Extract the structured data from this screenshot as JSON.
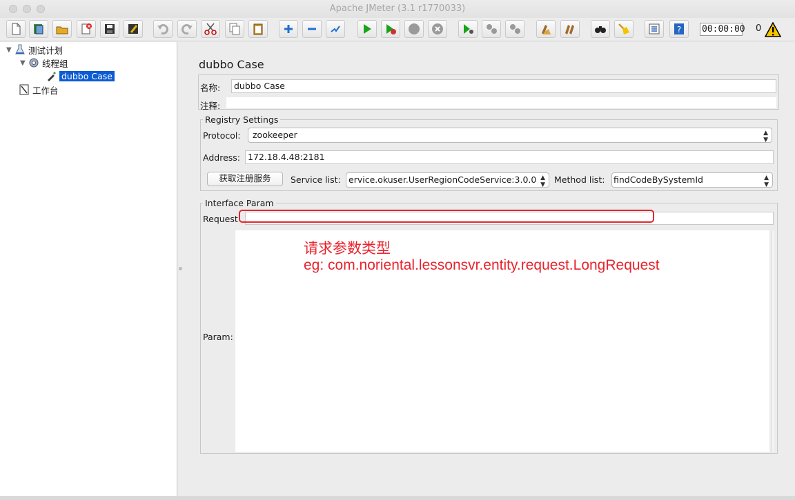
{
  "window": {
    "title": "Apache JMeter (3.1 r1770033)"
  },
  "toolbar": {
    "buttons": [
      "new-icon",
      "templates-icon",
      "open-icon",
      "close-icon",
      "save-icon",
      "save-as-icon",
      "undo-icon",
      "redo-icon",
      "cut-icon",
      "copy-icon",
      "paste-icon",
      "expand-icon",
      "collapse-icon",
      "toggle-icon",
      "start-icon",
      "start-no-pause-icon",
      "stop-icon",
      "shutdown-icon",
      "remote-start-icon",
      "remote-stop-icon",
      "remote-shutdown-icon",
      "clear-icon",
      "clear-all-icon",
      "search-icon",
      "reset-search-icon",
      "function-helper-icon",
      "help-icon"
    ],
    "timer": "00:00:00",
    "error_count": "0"
  },
  "tree": {
    "test_plan": "测试计划",
    "thread_group": "线程组",
    "sampler": "dubbo Case",
    "workbench": "工作台"
  },
  "form": {
    "title": "dubbo Case",
    "name_label": "名称:",
    "name_value": "dubbo Case",
    "comment_label": "注释:",
    "comment_value": "",
    "registry": {
      "legend": "Registry Settings",
      "protocol_label": "Protocol:",
      "protocol_value": "zookeeper",
      "address_label": "Address:",
      "address_value": "172.18.4.48:2181",
      "fetch_button": "获取注册服务",
      "service_label": "Service list:",
      "service_value": "ervice.okuser.UserRegionCodeService:3.0.0",
      "method_label": "Method list:",
      "method_value": "findCodeBySystemId"
    },
    "interface": {
      "legend": "Interface Param",
      "request_label": "Request",
      "request_value": "",
      "param_label": "Param:"
    }
  },
  "annotation": {
    "line1": "请求参数类型",
    "line2": "eg: com.noriental.lessonsvr.entity.request.LongRequest",
    "color": "#e8232c"
  }
}
